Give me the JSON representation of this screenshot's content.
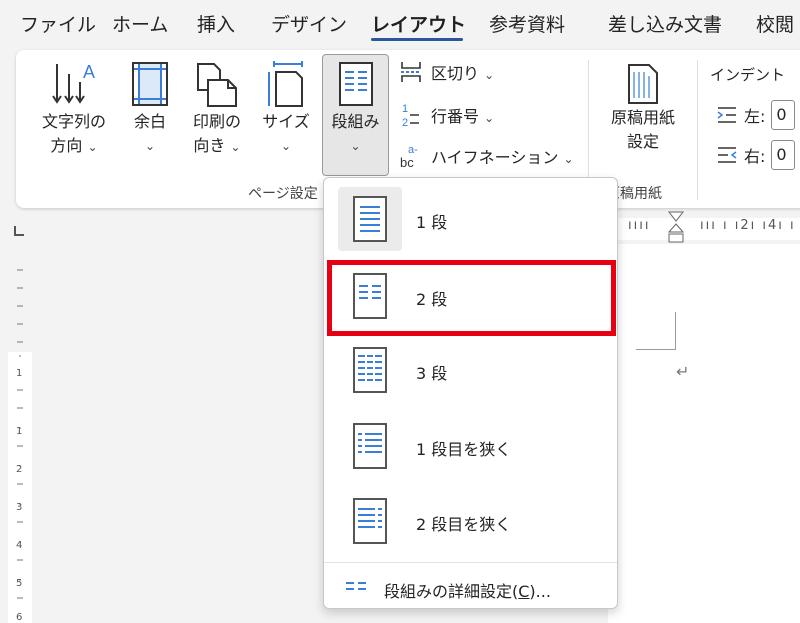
{
  "tabs": [
    {
      "label": "ファイル"
    },
    {
      "label": "ホーム"
    },
    {
      "label": "挿入"
    },
    {
      "label": "デザイン"
    },
    {
      "label": "レイアウト",
      "active": true
    },
    {
      "label": "参考資料"
    },
    {
      "label": "差し込み文書"
    },
    {
      "label": "校閲"
    }
  ],
  "ribbon": {
    "text_direction": {
      "line1": "文字列の",
      "line2": "方向"
    },
    "margins": {
      "label": "余白"
    },
    "orientation": {
      "line1": "印刷の",
      "line2": "向き"
    },
    "size": {
      "label": "サイズ"
    },
    "columns": {
      "label": "段組み"
    },
    "breaks": {
      "label": "区切り"
    },
    "line_numbers": {
      "label": "行番号"
    },
    "hyphenation": {
      "label": "ハイフネーション"
    },
    "page_setup_group": "ページ設定",
    "manuscript": {
      "line1": "原稿用紙",
      "line2": "設定"
    },
    "manuscript_group": "原稿用紙",
    "indent": {
      "title": "インデント",
      "left_label": "左:",
      "left_value": "0",
      "right_label": "右:",
      "right_value": "0"
    },
    "chevron": "⌄",
    "chevron_small": "⌄"
  },
  "ruler": {
    "h_text": "ııı ı  ı2ı ı4ı ı"
  },
  "document": {
    "para_mark": "↵"
  },
  "dropdown": {
    "items": [
      {
        "label": "1 段",
        "selected": true
      },
      {
        "label": "2 段",
        "highlighted": true
      },
      {
        "label": "3 段"
      },
      {
        "label": "1 段目を狭く"
      },
      {
        "label": "2 段目を狭く"
      }
    ],
    "footer": {
      "label_pre": "段組みの詳細設定(",
      "label_key": "C",
      "label_post": ")..."
    }
  },
  "colors": {
    "accent": "#2b579a",
    "highlight": "#e60012",
    "icon_blue": "#3a7fd5"
  }
}
